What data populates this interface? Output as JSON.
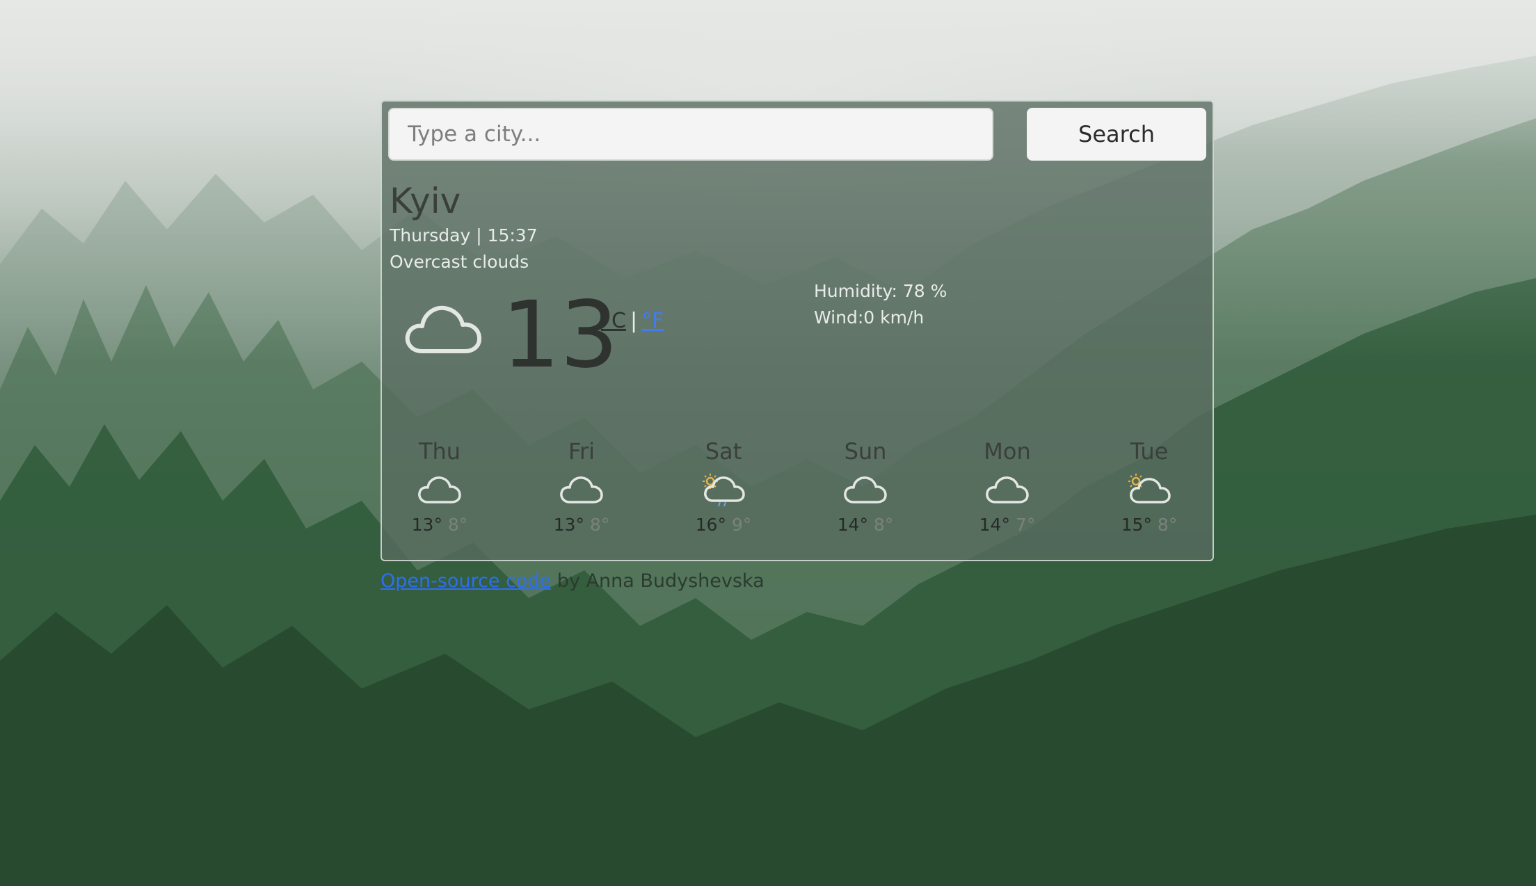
{
  "search": {
    "placeholder": "Type a city...",
    "button_label": "Search"
  },
  "weather": {
    "city": "Kyiv",
    "datetime": "Thursday | 15:37",
    "description": "Overcast clouds",
    "icon": "cloud-icon",
    "temperature": "13",
    "unit_c": "°C",
    "unit_separator": "|",
    "unit_f": "°F",
    "humidity": "Humidity: 78 %",
    "wind": "Wind:0 km/h"
  },
  "forecast": [
    {
      "day": "Thu",
      "icon": "cloud-icon",
      "max": "13°",
      "min": "8°"
    },
    {
      "day": "Fri",
      "icon": "cloud-icon",
      "max": "13°",
      "min": "8°"
    },
    {
      "day": "Sat",
      "icon": "sun-rain-cloud-icon",
      "max": "16°",
      "min": "9°"
    },
    {
      "day": "Sun",
      "icon": "cloud-icon",
      "max": "14°",
      "min": "8°"
    },
    {
      "day": "Mon",
      "icon": "cloud-icon",
      "max": "14°",
      "min": "7°"
    },
    {
      "day": "Tue",
      "icon": "sun-cloud-icon",
      "max": "15°",
      "min": "8°"
    }
  ],
  "footer": {
    "link_text": "Open-source code",
    "byline": " by Anna Budyshevska"
  },
  "colors": {
    "link": "#2f6ef0",
    "unit_f": "#3f7df0",
    "panel": "#586c60"
  }
}
